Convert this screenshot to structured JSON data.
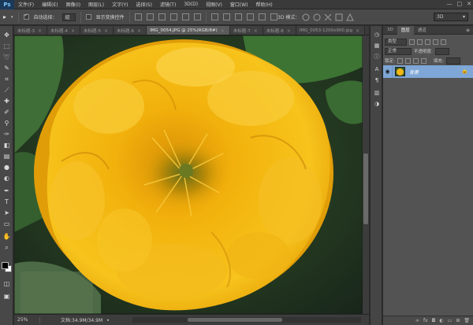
{
  "app": {
    "logo": "Ps"
  },
  "menu": [
    "文件(F)",
    "编辑(E)",
    "图像(I)",
    "图层(L)",
    "文字(Y)",
    "选择(S)",
    "滤镜(T)",
    "3D(D)",
    "视图(V)",
    "窗口(W)",
    "帮助(H)"
  ],
  "window_controls": [
    "—",
    "□",
    "✕"
  ],
  "options": {
    "auto_select_label": "自动选择：",
    "auto_select_value": "组",
    "show_transform_label": "显示变换控件",
    "mode_3d_label": "3D 模式：",
    "workspace": "3D"
  },
  "tabs": [
    {
      "label": "未标题-3",
      "active": false
    },
    {
      "label": "未标题-4",
      "active": false
    },
    {
      "label": "未标题-5",
      "active": false
    },
    {
      "label": "未标题-6",
      "active": false
    },
    {
      "label": "IMG_0054.JPG @ 25%(RGB/8#)",
      "active": true
    },
    {
      "label": "未标题-7",
      "active": false
    },
    {
      "label": "未标题-8",
      "active": false
    },
    {
      "label": "IMG_0053-1200x900.jpg",
      "active": false
    }
  ],
  "status": {
    "zoom": "25%",
    "doc_info": "文档:34.9M/34.9M"
  },
  "panel": {
    "tabs": [
      "3D",
      "图层",
      "通道"
    ],
    "active_tab": "图层",
    "kind_label": "类型",
    "blend_mode": "正常",
    "opacity_label": "不透明度:",
    "lock_label": "锁定:",
    "fill_label": "填充:",
    "layer_name": "背景"
  },
  "colors": {
    "foreground": "#000000",
    "background": "#ffffff",
    "layer_selected": "#7ea6d6",
    "accent": "#1b3a5a"
  },
  "tools": [
    "move-tool",
    "marquee-tool",
    "lasso-tool",
    "quick-select-tool",
    "crop-tool",
    "eyedropper-tool",
    "healing-tool",
    "brush-tool",
    "clone-stamp-tool",
    "history-brush-tool",
    "eraser-tool",
    "gradient-tool",
    "blur-tool",
    "dodge-tool",
    "pen-tool",
    "type-tool",
    "path-select-tool",
    "shape-tool",
    "hand-tool",
    "zoom-tool"
  ]
}
